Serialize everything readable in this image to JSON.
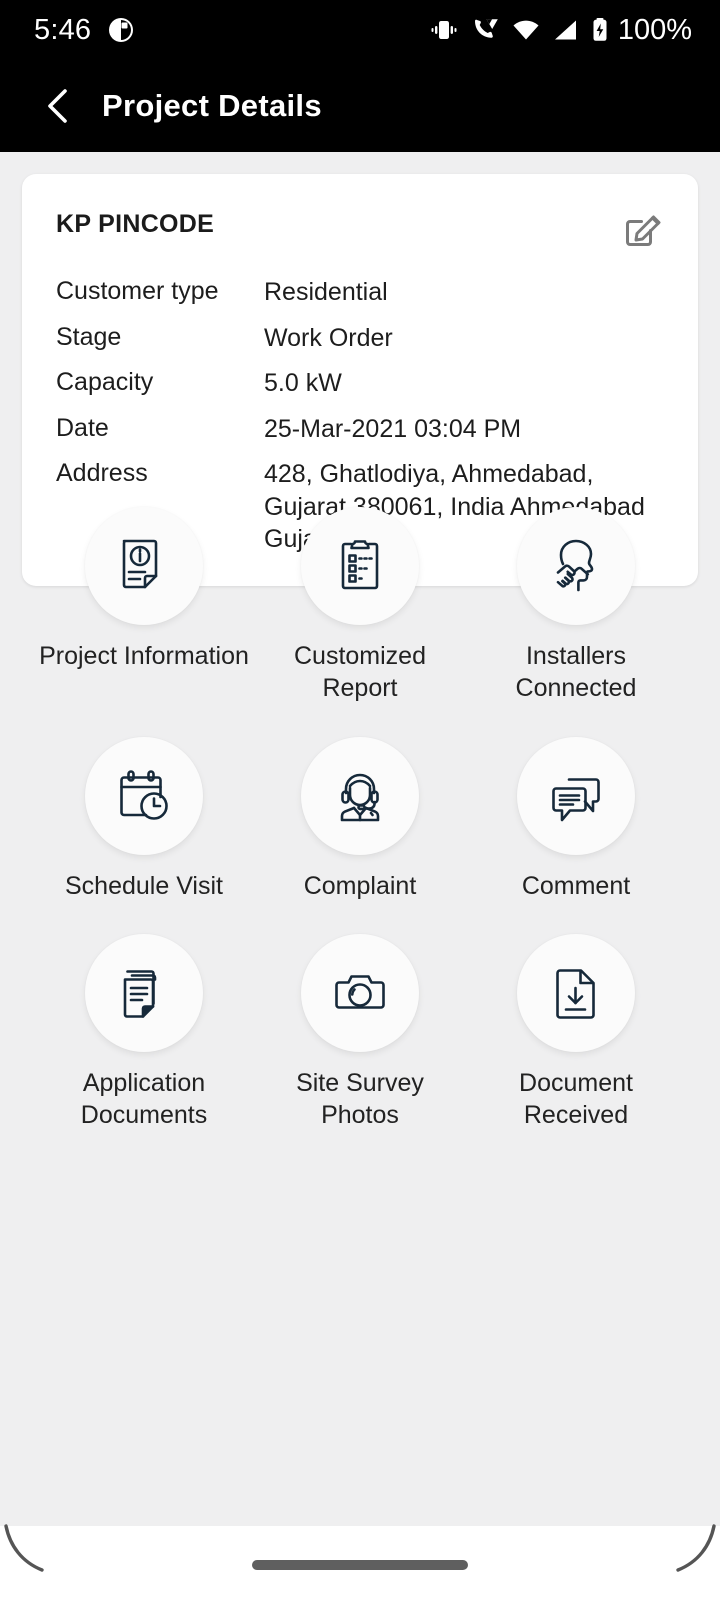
{
  "status_bar": {
    "time": "5:46",
    "notification_icon": "app-notification-icon",
    "icons": [
      "vibrate-icon",
      "wifi-calling-icon",
      "wifi-icon",
      "cellular-signal-icon",
      "battery-charging-icon"
    ],
    "battery_percent": "100%"
  },
  "app_bar": {
    "back_icon": "chevron-left-icon",
    "title": "Project Details"
  },
  "card": {
    "title": "KP PINCODE",
    "edit_icon": "edit-square-icon",
    "rows": [
      {
        "key": "Customer type",
        "value": "Residential"
      },
      {
        "key": "Stage",
        "value": "Work Order"
      },
      {
        "key": "Capacity",
        "value": "5.0 kW"
      },
      {
        "key": "Date",
        "value": "25-Mar-2021 03:04 PM"
      },
      {
        "key": "Address",
        "value": "428, Ghatlodiya, Ahmedabad, Gujarat 380061, India Ahmedabad Gujarat"
      }
    ]
  },
  "actions": [
    {
      "label": "Project Information",
      "icon": "document-info-icon"
    },
    {
      "label": "Customized Report",
      "icon": "clipboard-checklist-icon"
    },
    {
      "label": "Installers Connected",
      "icon": "handshake-head-icon"
    },
    {
      "label": "Schedule Visit",
      "icon": "calendar-clock-icon"
    },
    {
      "label": "Complaint",
      "icon": "headset-agent-icon"
    },
    {
      "label": "Comment",
      "icon": "speech-bubbles-icon"
    },
    {
      "label": "Application Documents",
      "icon": "stacked-documents-icon"
    },
    {
      "label": "Site Survey Photos",
      "icon": "camera-icon"
    },
    {
      "label": "Document Received",
      "icon": "document-download-icon"
    }
  ],
  "nav_bar": {
    "handle": "gesture-home-handle"
  },
  "colors": {
    "background": "#efeff0",
    "card": "#ffffff",
    "appbar": "#000000",
    "icon_stroke": "#16293a",
    "tile_circle": "#fbfbfb",
    "edit_icon": "#7b7b7b"
  }
}
